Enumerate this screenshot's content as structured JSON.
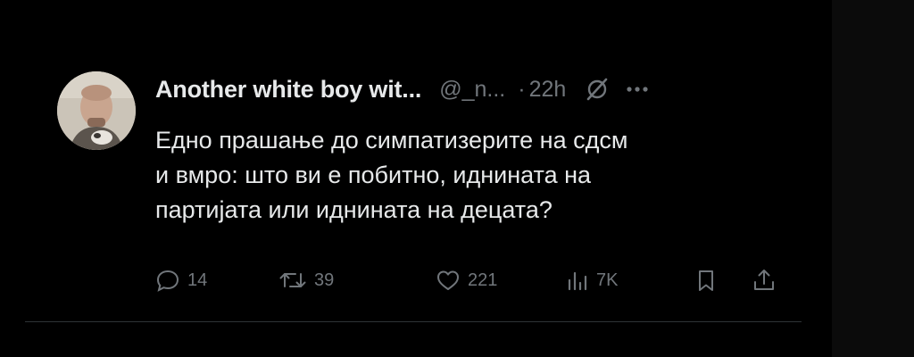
{
  "tweet": {
    "display_name": "Another white boy wit...",
    "handle": "@_n...",
    "separator": "·",
    "time": "22h",
    "text_lines": [
      "Едно прашање до симпатизерите на сдсм",
      "и вмро: што ви е побитно, иднината на",
      "партијата или иднината на децата?"
    ],
    "icons": {
      "grok": "grok-slash-icon",
      "more": "more-icon"
    }
  },
  "actions": {
    "reply": {
      "icon": "reply-icon",
      "count": "14"
    },
    "retweet": {
      "icon": "retweet-icon",
      "count": "39"
    },
    "like": {
      "icon": "heart-icon",
      "count": "221"
    },
    "views": {
      "icon": "views-icon",
      "count": "7K"
    },
    "bookmark": {
      "icon": "bookmark-icon"
    },
    "share": {
      "icon": "share-icon"
    }
  },
  "colors": {
    "background": "#000000",
    "text": "#e7e9ea",
    "muted": "#71767b",
    "divider": "#2f3336"
  }
}
